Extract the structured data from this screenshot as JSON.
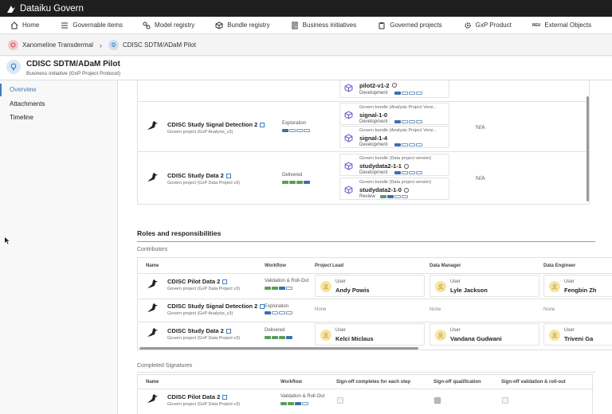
{
  "app": {
    "title": "Dataiku Govern"
  },
  "nav": [
    {
      "label": "Home",
      "icon": "home-icon"
    },
    {
      "label": "Governable items",
      "icon": "list-icon"
    },
    {
      "label": "Model registry",
      "icon": "model-icon"
    },
    {
      "label": "Bundle registry",
      "icon": "cube-icon"
    },
    {
      "label": "Business initiatives",
      "icon": "document-icon"
    },
    {
      "label": "Governed projects",
      "icon": "clipboard-icon"
    },
    {
      "label": "GxP Product",
      "icon": "gear-icon"
    },
    {
      "label": "External Objects",
      "icon": "neu-icon"
    }
  ],
  "breadcrumb": {
    "item1": "Xanomeline Transdermal",
    "item2": "CDISC SDTM/ADaM Pilot"
  },
  "header": {
    "title": "CDISC SDTM/ADaM Pilot",
    "subtitle": "Business initiative (GxP Project Protocol)"
  },
  "sidebar": {
    "items": [
      "Overview",
      "Attachments",
      "Timeline"
    ]
  },
  "colors": {
    "accent": "#3b7fc4",
    "progress_done": "#5b9e5b",
    "progress_current": "#3d6fb0",
    "avatar_bg": "#f4e5a3"
  },
  "projects_table": {
    "top_bundle": {
      "name": "pilot2-v1-2",
      "status": "Development"
    },
    "rows": [
      {
        "name": "CDISC Study Signal Detection 2",
        "type": "Govern project (GxP Analysis_v3)",
        "workflow": "Exploration",
        "na": "N/A",
        "bundles": [
          {
            "kind": "Govern bundle (Analysis Project Versi...",
            "name": "signal-1-0",
            "status": "Development"
          },
          {
            "kind": "Govern bundle (Analysis Project Versi...",
            "name": "signal-1-4",
            "status": "Development"
          }
        ]
      },
      {
        "name": "CDISC Study Data 2",
        "type": "Govern project (GxP Data Project v3)",
        "workflow": "Delivered",
        "na": "N/A",
        "bundles": [
          {
            "kind": "Govern bundle (Data project version)",
            "name": "studydata2-1-1",
            "status": "Development"
          },
          {
            "kind": "Govern bundle (Data project version)",
            "name": "studydata2-1-0",
            "status": "Review"
          }
        ]
      }
    ]
  },
  "roles": {
    "title": "Roles and responsibilities",
    "contributors_label": "Contributors",
    "columns": [
      "Name",
      "Workflow",
      "Project Lead",
      "Data Manager",
      "Data Engineer"
    ],
    "user_label": "User",
    "none_label": "None",
    "rows": [
      {
        "name": "CDISC Pilot Data 2",
        "type": "Govern project (GxP Data Project v3)",
        "workflow": "Validation & Roll-Out",
        "lead": "Andy Powis",
        "manager": "Lyle Jackson",
        "engineer": "Fengbin Zh"
      },
      {
        "name": "CDISC Study Signal Detection 2",
        "type": "Govern project (GxP Analysis_v3)",
        "workflow": "Exploration",
        "lead": "None",
        "manager": "None",
        "engineer": "None"
      },
      {
        "name": "CDISC Study Data 2",
        "type": "Govern project (GxP Data Project v3)",
        "workflow": "Delivered",
        "lead": "Kelci Miclaus",
        "manager": "Vandana Gudwani",
        "engineer": "Triveni Ga"
      }
    ]
  },
  "signatures": {
    "title": "Completed Signatures",
    "columns": [
      "Name",
      "Workflow",
      "Sign-off completes for each step",
      "Sign-off qualification",
      "Sign-off validation & roll-out"
    ],
    "rows": [
      {
        "name": "CDISC Pilot Data 2",
        "type": "Govern project (GxP Data Project v3)",
        "workflow": "Validation & Roll-Out",
        "step": false,
        "qualification": true,
        "validation": false
      }
    ]
  }
}
